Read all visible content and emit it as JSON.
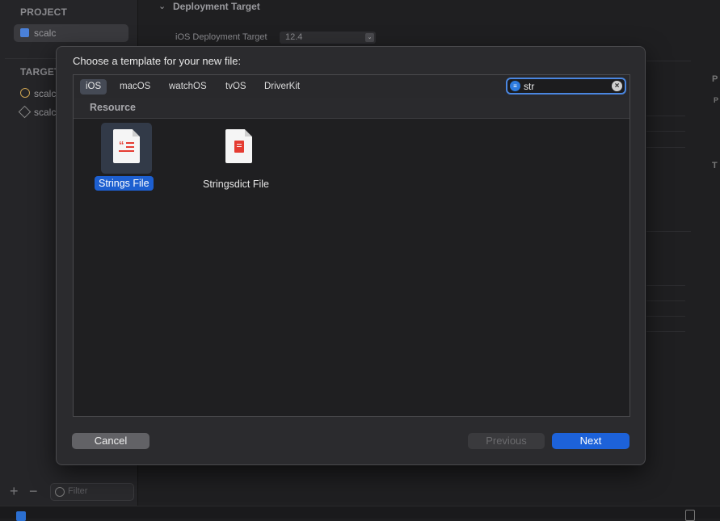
{
  "sidebar": {
    "project_header": "PROJECT",
    "project_item": "scalc",
    "targets_header": "TARGETS",
    "targets": [
      "scalc",
      "scalc"
    ],
    "filter_placeholder": "Filter"
  },
  "settings": {
    "section_title": "Deployment Target",
    "label": "iOS Deployment Target",
    "value": "12.4",
    "right_fragments": [
      "P",
      "P",
      "T"
    ]
  },
  "dialog": {
    "title": "Choose a template for your new file:",
    "platform_tabs": [
      "iOS",
      "macOS",
      "watchOS",
      "tvOS",
      "DriverKit"
    ],
    "active_tab": "iOS",
    "search": {
      "value": "str"
    },
    "section": "Resource",
    "templates": [
      {
        "label": "Strings File",
        "icon": "strings-file-icon",
        "selected": true
      },
      {
        "label": "Stringsdict File",
        "icon": "stringsdict-file-icon",
        "selected": false
      }
    ],
    "buttons": {
      "cancel": "Cancel",
      "previous": "Previous",
      "next": "Next"
    }
  },
  "colors": {
    "accent": "#1d62d9",
    "icon_red": "#e53c32",
    "background": "#1e1e20",
    "sheet": "#2b2b2e"
  }
}
